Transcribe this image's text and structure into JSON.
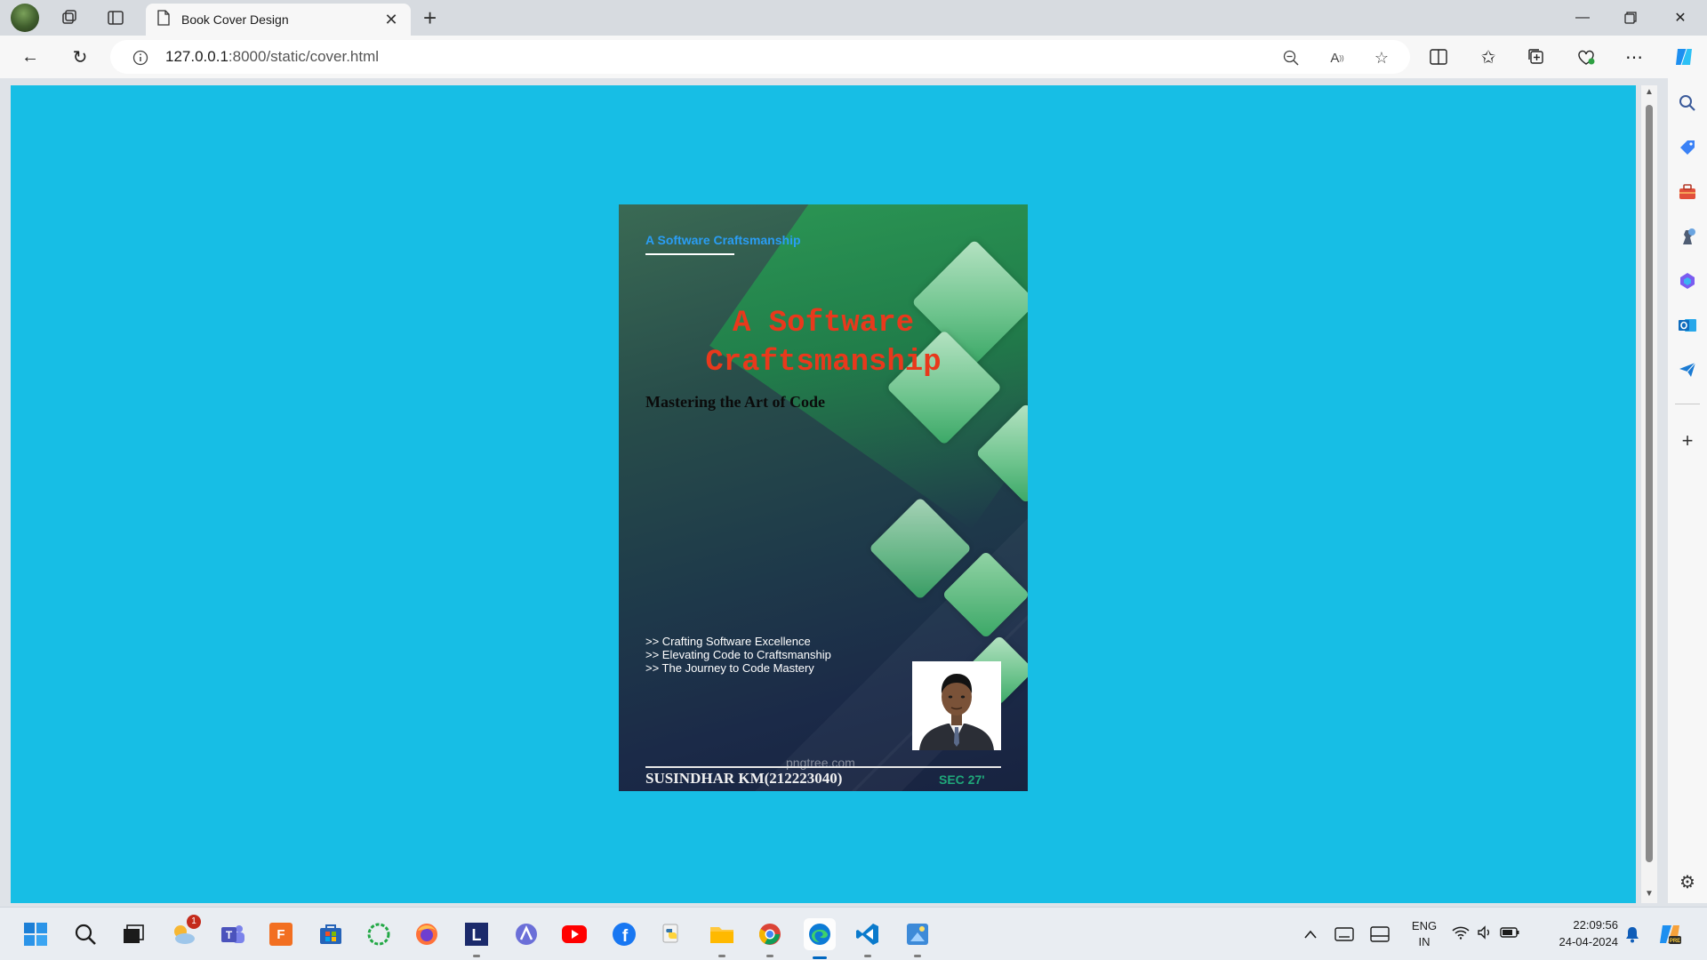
{
  "browser": {
    "tab_title": "Book Cover Design",
    "url_host": "127.0.0.1",
    "url_path": ":8000/static/cover.html",
    "icons": [
      "workspaces-icon",
      "tab-actions-icon",
      "page-icon",
      "close-icon",
      "new-tab-icon",
      "minimize-icon",
      "restore-icon",
      "window-close-icon",
      "back-icon",
      "refresh-icon",
      "info-icon",
      "zoom-out-icon",
      "read-aloud-icon",
      "favorite-star-icon",
      "split-screen-icon",
      "favorites-icon",
      "collections-icon",
      "browser-essentials-icon",
      "more-icon",
      "copilot-icon"
    ]
  },
  "sidebar": {
    "icons": [
      "search-icon",
      "shopping-tag-icon",
      "tools-icon",
      "games-icon",
      "office-icon",
      "outlook-icon",
      "send-icon",
      "add-icon",
      "settings-icon"
    ]
  },
  "cover": {
    "top_text": "A Software Craftsmanship",
    "title_line1": "A Software",
    "title_line2": "Craftsmanship",
    "subtitle": "Mastering the Art of Code",
    "points": [
      ">> Crafting Software Excellence",
      ">> Elevating Code to Craftsmanship",
      ">> The Journey to Code Mastery"
    ],
    "watermark": "pngtree.com",
    "author": "SUSINDHAR KM(212223040)",
    "section": "SEC 27'",
    "colors": {
      "page_background": "#17bee5",
      "title": "#e8391c",
      "top_text": "#2a9df4",
      "section": "#1fa87a"
    }
  },
  "taskbar": {
    "apps": [
      "start-icon",
      "search-icon",
      "task-view-icon",
      "weather-icon",
      "teams-icon",
      "fusion360-icon",
      "store-icon",
      "circle-app-icon",
      "firefox-icon",
      "l-app-icon",
      "arc-icon",
      "youtube-icon",
      "facebook-icon",
      "python-icon",
      "file-explorer-icon",
      "chrome-icon",
      "edge-icon",
      "vscode-icon",
      "paint-icon"
    ],
    "weather_badge": "1",
    "language_line1": "ENG",
    "language_line2": "IN",
    "time": "22:09:56",
    "date": "24-04-2024"
  }
}
